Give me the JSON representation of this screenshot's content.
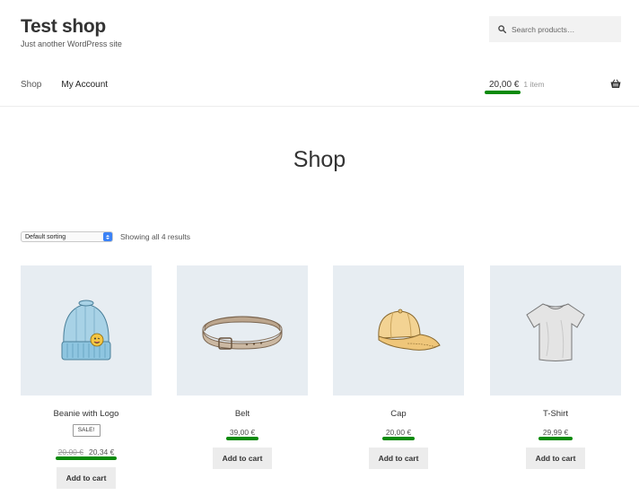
{
  "site": {
    "title": "Test shop",
    "tagline": "Just another WordPress site"
  },
  "search": {
    "placeholder": "Search products…",
    "icon": "search-icon"
  },
  "nav": {
    "items": [
      {
        "label": "Shop"
      },
      {
        "label": "My Account"
      }
    ]
  },
  "cart": {
    "amount": "20,00 €",
    "count": "1 item",
    "icon": "basket-icon"
  },
  "page": {
    "title": "Shop"
  },
  "sorting": {
    "selected": "Default sorting"
  },
  "results": {
    "text": "Showing all 4 results"
  },
  "colors": {
    "highlight": "#0a8a0a",
    "thumb_bg": "#e7edf2",
    "button_bg": "#ececec"
  },
  "products": [
    {
      "name": "Beanie with Logo",
      "sale_badge": "SALE!",
      "old_price": "20,00 €",
      "price": "20,34 €",
      "button": "Add to cart",
      "image": "beanie-icon"
    },
    {
      "name": "Belt",
      "price": "39,00 €",
      "button": "Add to cart",
      "image": "belt-icon"
    },
    {
      "name": "Cap",
      "price": "20,00 €",
      "button": "Add to cart",
      "image": "cap-icon"
    },
    {
      "name": "T-Shirt",
      "price": "29,99 €",
      "button": "Add to cart",
      "image": "tshirt-icon"
    }
  ]
}
